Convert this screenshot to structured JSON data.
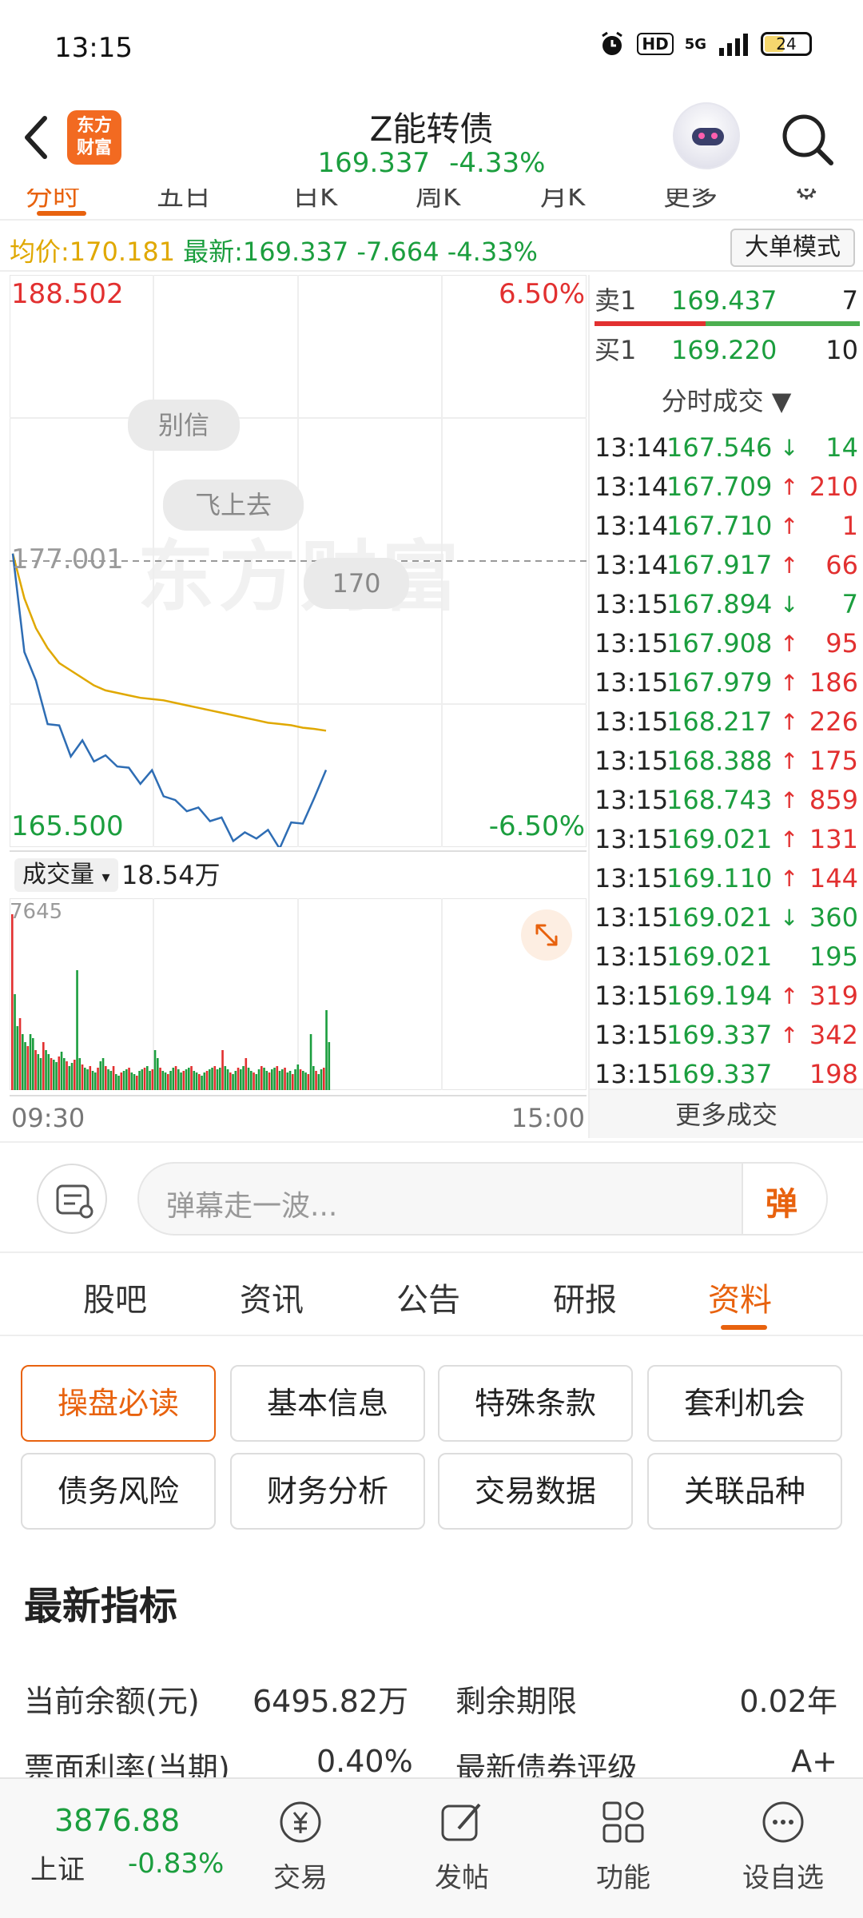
{
  "status": {
    "time": "13:15",
    "battery": "24",
    "network": "5G"
  },
  "header": {
    "logo_line1": "东方",
    "logo_line2": "财富",
    "title": "Z能转债",
    "price": "169.337",
    "change_pct": "-4.33%"
  },
  "tabs": [
    "分时",
    "五日",
    "日K",
    "周K",
    "月K",
    "更多",
    "⚙"
  ],
  "info": {
    "avg_label": "均价:",
    "avg_value": "170.181",
    "new_label": "最新:",
    "new_value": "169.337",
    "change": "-7.664",
    "change_pct": "-4.33%",
    "mode_button": "大单模式"
  },
  "chart": {
    "top_price": "188.502",
    "top_pct": "6.50%",
    "mid_price": "177.001",
    "bottom_price": "165.500",
    "bottom_pct": "-6.50%",
    "watermark": "东方财富",
    "bubbles": [
      "别信",
      "飞上去",
      "170"
    ],
    "volume_label": "成交量",
    "volume_value": "18.54万",
    "vol_max": "7645",
    "time_start": "09:30",
    "time_end": "15:00"
  },
  "chart_data": {
    "type": "line",
    "ylim": [
      165.5,
      188.502
    ],
    "series": [
      {
        "values": [
          177.3,
          173.6,
          172.0,
          170.7,
          170.2,
          169.4,
          169.6,
          169.2,
          169.0,
          169.0,
          168.5,
          168.3,
          168.4,
          167.8,
          167.2,
          167.2,
          166.9,
          166.8,
          166.5,
          166.0,
          165.9,
          166.1,
          166.0,
          165.7,
          166.3,
          166.7,
          167.3,
          168.6
        ]
      },
      {
        "values": [
          177.3,
          175.5,
          174.3,
          173.5,
          172.9,
          172.6,
          172.3,
          172.0,
          171.8,
          171.7,
          171.6,
          171.5,
          171.45,
          171.4,
          171.3,
          171.2,
          171.1,
          171.0,
          170.9,
          170.8,
          170.7,
          170.6,
          170.5,
          170.45,
          170.4,
          170.3,
          170.25,
          170.18
        ]
      }
    ]
  },
  "book": {
    "sell1_label": "卖1",
    "sell1_price": "169.437",
    "sell1_vol": "7",
    "buy1_label": "买1",
    "buy1_price": "169.220",
    "buy1_vol": "10",
    "deals_title": "分时成交 ▼",
    "more_deals": "更多成交"
  },
  "deals": [
    {
      "time": "13:14",
      "price": "167.546",
      "dir": "↓",
      "vol": "14"
    },
    {
      "time": "13:14",
      "price": "167.709",
      "dir": "↑",
      "vol": "210"
    },
    {
      "time": "13:14",
      "price": "167.710",
      "dir": "↑",
      "vol": "1"
    },
    {
      "time": "13:14",
      "price": "167.917",
      "dir": "↑",
      "vol": "66"
    },
    {
      "time": "13:15",
      "price": "167.894",
      "dir": "↓",
      "vol": "7"
    },
    {
      "time": "13:15",
      "price": "167.908",
      "dir": "↑",
      "vol": "95"
    },
    {
      "time": "13:15",
      "price": "167.979",
      "dir": "↑",
      "vol": "186"
    },
    {
      "time": "13:15",
      "price": "168.217",
      "dir": "↑",
      "vol": "226"
    },
    {
      "time": "13:15",
      "price": "168.388",
      "dir": "↑",
      "vol": "175"
    },
    {
      "time": "13:15",
      "price": "168.743",
      "dir": "↑",
      "vol": "859"
    },
    {
      "time": "13:15",
      "price": "169.021",
      "dir": "↑",
      "vol": "131"
    },
    {
      "time": "13:15",
      "price": "169.110",
      "dir": "↑",
      "vol": "144"
    },
    {
      "time": "13:15",
      "price": "169.021",
      "dir": "↓",
      "vol": "360"
    },
    {
      "time": "13:15",
      "price": "169.021",
      "dir": "",
      "vol": "195"
    },
    {
      "time": "13:15",
      "price": "169.194",
      "dir": "↑",
      "vol": "319"
    },
    {
      "time": "13:15",
      "price": "169.337",
      "dir": "↑",
      "vol": "342"
    },
    {
      "time": "13:15",
      "price": "169.337",
      "dir": "",
      "vol": "198"
    }
  ],
  "danmaku": {
    "placeholder": "弹幕走一波...",
    "send": "弹"
  },
  "section_tabs": [
    "股吧",
    "资讯",
    "公告",
    "研报",
    "资料"
  ],
  "grid_buttons": [
    "操盘必读",
    "基本信息",
    "特殊条款",
    "套利机会",
    "债务风险",
    "财务分析",
    "交易数据",
    "关联品种"
  ],
  "indicators": {
    "title": "最新指标",
    "r1_label": "当前余额(元)",
    "r1_value": "6495.82万",
    "r1_label2": "剩余期限",
    "r1_value2": "0.02年",
    "r2_label": "票面利率(当期)",
    "r2_value": "0.40%",
    "r2_label2": "最新债券评级",
    "r2_value2": "A+"
  },
  "bottom": {
    "index_value": "3876.88",
    "index_name": "上证",
    "index_pct": "-0.83%",
    "nav": [
      "交易",
      "发帖",
      "功能",
      "设自选"
    ]
  },
  "colors": {
    "up": "#e23030",
    "down": "#1b9e3e",
    "accent": "#e8620e",
    "avg_line": "#e0a800",
    "price_line": "#2e6db4"
  }
}
